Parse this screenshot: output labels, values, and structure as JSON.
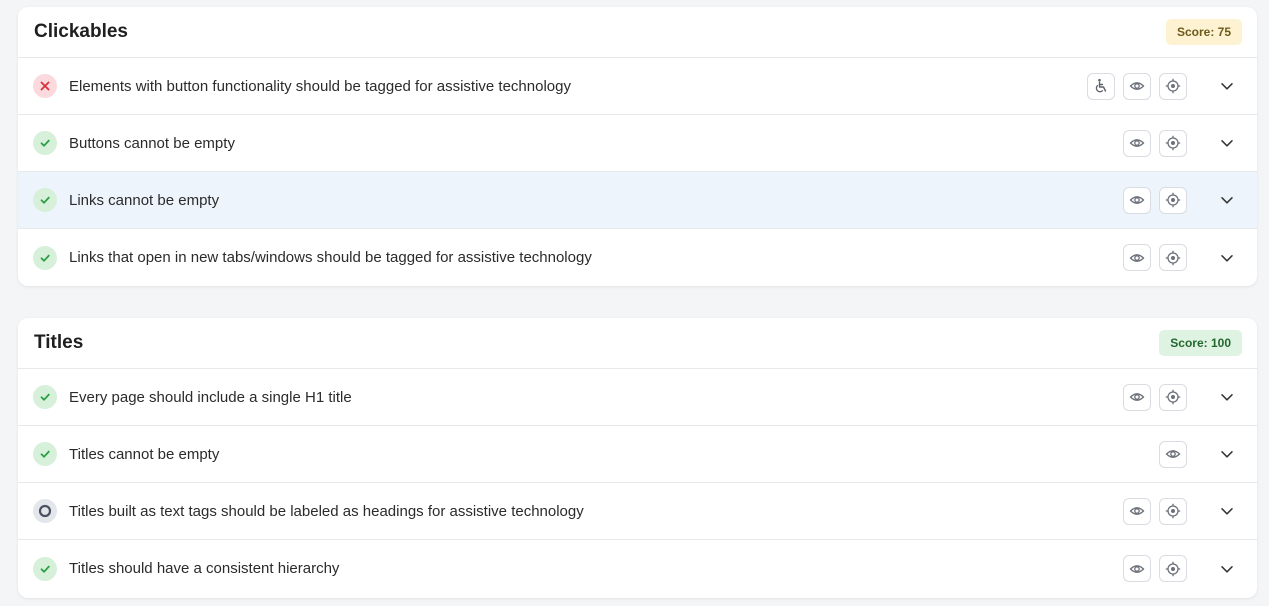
{
  "sections": [
    {
      "title": "Clickables",
      "score_label": "Score: 75",
      "rows": [
        {
          "label": "Elements with button functionality should be tagged for assistive technology",
          "status": "fail",
          "actions": [
            "accessibility-icon",
            "eye-icon",
            "target-icon"
          ],
          "highlight": false
        },
        {
          "label": "Buttons cannot be empty",
          "status": "pass",
          "actions": [
            "eye-icon",
            "target-icon"
          ],
          "highlight": false
        },
        {
          "label": "Links cannot be empty",
          "status": "pass",
          "actions": [
            "eye-icon",
            "target-icon"
          ],
          "highlight": true
        },
        {
          "label": "Links that open in new tabs/windows should be tagged for assistive technology",
          "status": "pass",
          "actions": [
            "eye-icon",
            "target-icon"
          ],
          "highlight": false
        }
      ]
    },
    {
      "title": "Titles",
      "score_label": "Score: 100",
      "rows": [
        {
          "label": "Every page should include a single H1 title",
          "status": "pass",
          "actions": [
            "eye-icon",
            "target-icon"
          ],
          "highlight": false
        },
        {
          "label": "Titles cannot be empty",
          "status": "pass",
          "actions": [
            "eye-icon"
          ],
          "highlight": false
        },
        {
          "label": "Titles built as text tags should be labeled as headings for assistive technology",
          "status": "neutral",
          "actions": [
            "eye-icon",
            "target-icon"
          ],
          "highlight": false
        },
        {
          "label": "Titles should have a consistent hierarchy",
          "status": "pass",
          "actions": [
            "eye-icon",
            "target-icon"
          ],
          "highlight": false
        }
      ]
    }
  ],
  "colors": {
    "pass": "#2e9e45",
    "fail": "#d9303e",
    "neutral": "#4a5160",
    "score_warn_bg": "#fdf3d2",
    "score_good_bg": "#dff3e2",
    "icon_gray": "#8a8f98"
  }
}
